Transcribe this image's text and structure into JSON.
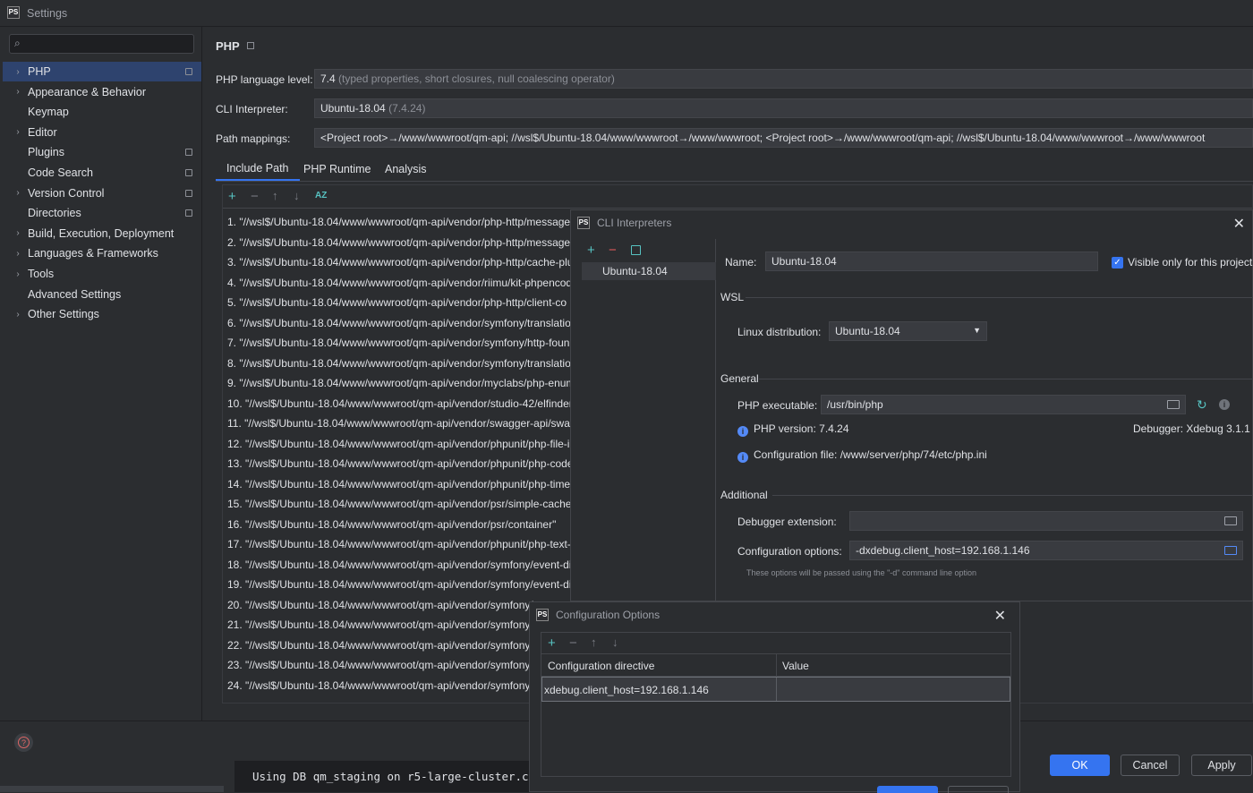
{
  "window": {
    "title": "Settings",
    "logo": "PS"
  },
  "search": {
    "placeholder": ""
  },
  "sidebar": {
    "items": [
      {
        "label": "PHP",
        "chevron": true,
        "pin": true,
        "selected": true
      },
      {
        "label": "Appearance & Behavior",
        "chevron": true,
        "pin": false
      },
      {
        "label": "Keymap",
        "chevron": false,
        "pin": false
      },
      {
        "label": "Editor",
        "chevron": true,
        "pin": false
      },
      {
        "label": "Plugins",
        "chevron": false,
        "pin": true
      },
      {
        "label": "Code Search",
        "chevron": false,
        "pin": true
      },
      {
        "label": "Version Control",
        "chevron": true,
        "pin": true
      },
      {
        "label": "Directories",
        "chevron": false,
        "pin": true
      },
      {
        "label": "Build, Execution, Deployment",
        "chevron": true,
        "pin": false
      },
      {
        "label": "Languages & Frameworks",
        "chevron": true,
        "pin": false
      },
      {
        "label": "Tools",
        "chevron": true,
        "pin": false
      },
      {
        "label": "Advanced Settings",
        "chevron": false,
        "pin": false
      },
      {
        "label": "Other Settings",
        "chevron": true,
        "pin": false
      }
    ]
  },
  "php": {
    "title": "PHP",
    "language_level_label": "PHP language level:",
    "language_level_value": "7.4",
    "language_level_desc": "(typed properties, short closures, null coalescing operator)",
    "cli_label": "CLI Interpreter:",
    "cli_value": "Ubuntu-18.04",
    "cli_version": "(7.4.24)",
    "path_label": "Path mappings:",
    "path_value": "<Project root>→/www/wwwroot/qm-api; //wsl$/Ubuntu-18.04/www/wwwroot→/www/wwwroot; <Project root>→/www/wwwroot/qm-api; //wsl$/Ubuntu-18.04/www/wwwroot→/www/wwwroot"
  },
  "tabs": [
    "Include Path",
    "PHP Runtime",
    "Analysis"
  ],
  "include_paths": [
    "1. \"//wsl$/Ubuntu-18.04/www/wwwroot/qm-api/vendor/php-http/message\"",
    "2. \"//wsl$/Ubuntu-18.04/www/wwwroot/qm-api/vendor/php-http/message-",
    "3. \"//wsl$/Ubuntu-18.04/www/wwwroot/qm-api/vendor/php-http/cache-plu",
    "4. \"//wsl$/Ubuntu-18.04/www/wwwroot/qm-api/vendor/riimu/kit-phpencod",
    "5. \"//wsl$/Ubuntu-18.04/www/wwwroot/qm-api/vendor/php-http/client-co",
    "6. \"//wsl$/Ubuntu-18.04/www/wwwroot/qm-api/vendor/symfony/translation",
    "7. \"//wsl$/Ubuntu-18.04/www/wwwroot/qm-api/vendor/symfony/http-foun",
    "8. \"//wsl$/Ubuntu-18.04/www/wwwroot/qm-api/vendor/symfony/translation",
    "9. \"//wsl$/Ubuntu-18.04/www/wwwroot/qm-api/vendor/myclabs/php-enum",
    "10. \"//wsl$/Ubuntu-18.04/www/wwwroot/qm-api/vendor/studio-42/elfinder",
    "11. \"//wsl$/Ubuntu-18.04/www/wwwroot/qm-api/vendor/swagger-api/swag",
    "12. \"//wsl$/Ubuntu-18.04/www/wwwroot/qm-api/vendor/phpunit/php-file-i",
    "13. \"//wsl$/Ubuntu-18.04/www/wwwroot/qm-api/vendor/phpunit/php-code",
    "14. \"//wsl$/Ubuntu-18.04/www/wwwroot/qm-api/vendor/phpunit/php-time",
    "15. \"//wsl$/Ubuntu-18.04/www/wwwroot/qm-api/vendor/psr/simple-cache\"",
    "16. \"//wsl$/Ubuntu-18.04/www/wwwroot/qm-api/vendor/psr/container\"",
    "17. \"//wsl$/Ubuntu-18.04/www/wwwroot/qm-api/vendor/phpunit/php-text-",
    "18. \"//wsl$/Ubuntu-18.04/www/wwwroot/qm-api/vendor/symfony/event-dis",
    "19. \"//wsl$/Ubuntu-18.04/www/wwwroot/qm-api/vendor/symfony/event-dis",
    "20. \"//wsl$/Ubuntu-18.04/www/wwwroot/qm-api/vendor/symfony/",
    "21. \"//wsl$/Ubuntu-18.04/www/wwwroot/qm-api/vendor/symfony/",
    "22. \"//wsl$/Ubuntu-18.04/www/wwwroot/qm-api/vendor/symfony/",
    "23. \"//wsl$/Ubuntu-18.04/www/wwwroot/qm-api/vendor/symfony/",
    "24. \"//wsl$/Ubuntu-18.04/www/wwwroot/qm-api/vendor/symfony/"
  ],
  "cli_dialog": {
    "title": "CLI Interpreters",
    "list": [
      "Ubuntu-18.04"
    ],
    "name_label": "Name:",
    "name_value": "Ubuntu-18.04",
    "visible_only_label": "Visible only for this project",
    "visible_only_checked": true,
    "wsl_section": "WSL",
    "linux_dist_label": "Linux distribution:",
    "linux_dist_value": "Ubuntu-18.04",
    "general_section": "General",
    "php_exe_label": "PHP executable:",
    "php_exe_value": "/usr/bin/php",
    "php_version": "PHP version: 7.4.24",
    "debugger": "Debugger:  Xdebug 3.1.1",
    "config_file": "Configuration file: /www/server/php/74/etc/php.ini",
    "additional_section": "Additional",
    "debugger_ext_label": "Debugger extension:",
    "debugger_ext_value": "",
    "config_opts_label": "Configuration options:",
    "config_opts_value": "-dxdebug.client_host=192.168.1.146",
    "hint": "These options will be passed using the \"-d\" command line option"
  },
  "config_dialog": {
    "title": "Configuration Options",
    "col_directive": "Configuration directive",
    "col_value": "Value",
    "rows": [
      {
        "directive": "xdebug.client_host=192.168.1.146",
        "value": ""
      }
    ]
  },
  "buttons": {
    "ok": "OK",
    "cancel": "Cancel",
    "apply": "Apply",
    "help": "?"
  },
  "terminal": {
    "text": "Using DB qm_staging on r5-large-cluster.c"
  },
  "colors": {
    "accent": "#3574f0",
    "selection": "#2e436e",
    "bg": "#2b2d30",
    "add_icon": "#57c3c2",
    "remove_icon": "#e55b5b"
  }
}
